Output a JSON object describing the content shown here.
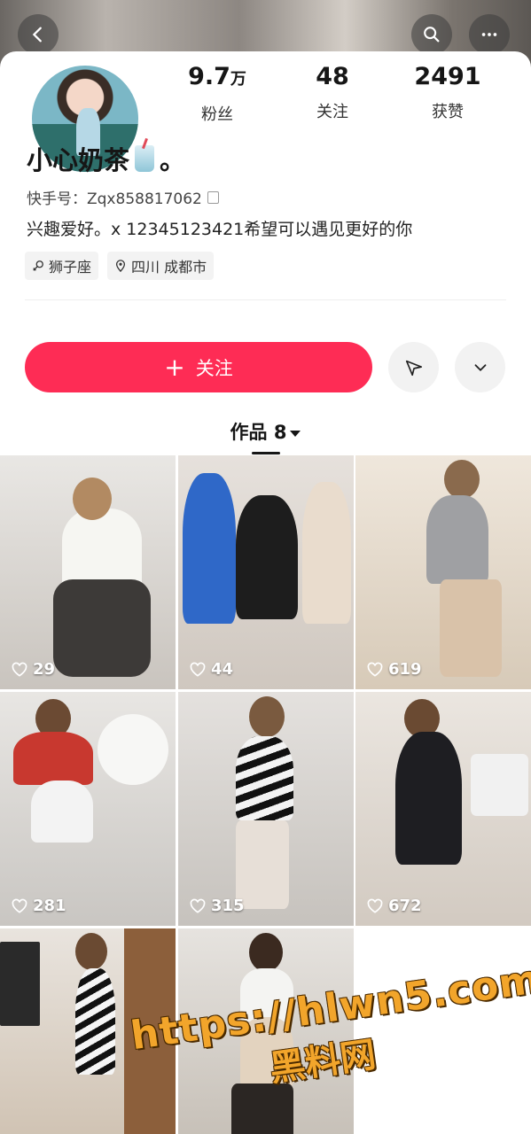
{
  "profile": {
    "name": "小心奶茶",
    "name_suffix": "。",
    "kuaishou_id": "快手号：Zqx858817062",
    "bio": "兴趣爱好。x 12345123421希望可以遇见更好的你",
    "tags": [
      "狮子座",
      "四川 成都市"
    ]
  },
  "stats": [
    {
      "value": "9.7",
      "unit": "万",
      "label": "粉丝"
    },
    {
      "value": "48",
      "unit": "",
      "label": "关注"
    },
    {
      "value": "2491",
      "unit": "",
      "label": "获赞"
    }
  ],
  "actions": {
    "follow_label": "关注",
    "follow_plus": "+"
  },
  "works_tab": {
    "label": "作品 8"
  },
  "works": [
    {
      "likes": "29"
    },
    {
      "likes": "44"
    },
    {
      "likes": "619"
    },
    {
      "likes": "281"
    },
    {
      "likes": "315"
    },
    {
      "likes": "672"
    },
    {
      "likes": ""
    },
    {
      "likes": ""
    }
  ],
  "watermark": {
    "url": "https://hlwn5.com",
    "site": "黑料网"
  },
  "colors": {
    "accent": "#fe2c55",
    "watermark": "#f2a52b"
  }
}
